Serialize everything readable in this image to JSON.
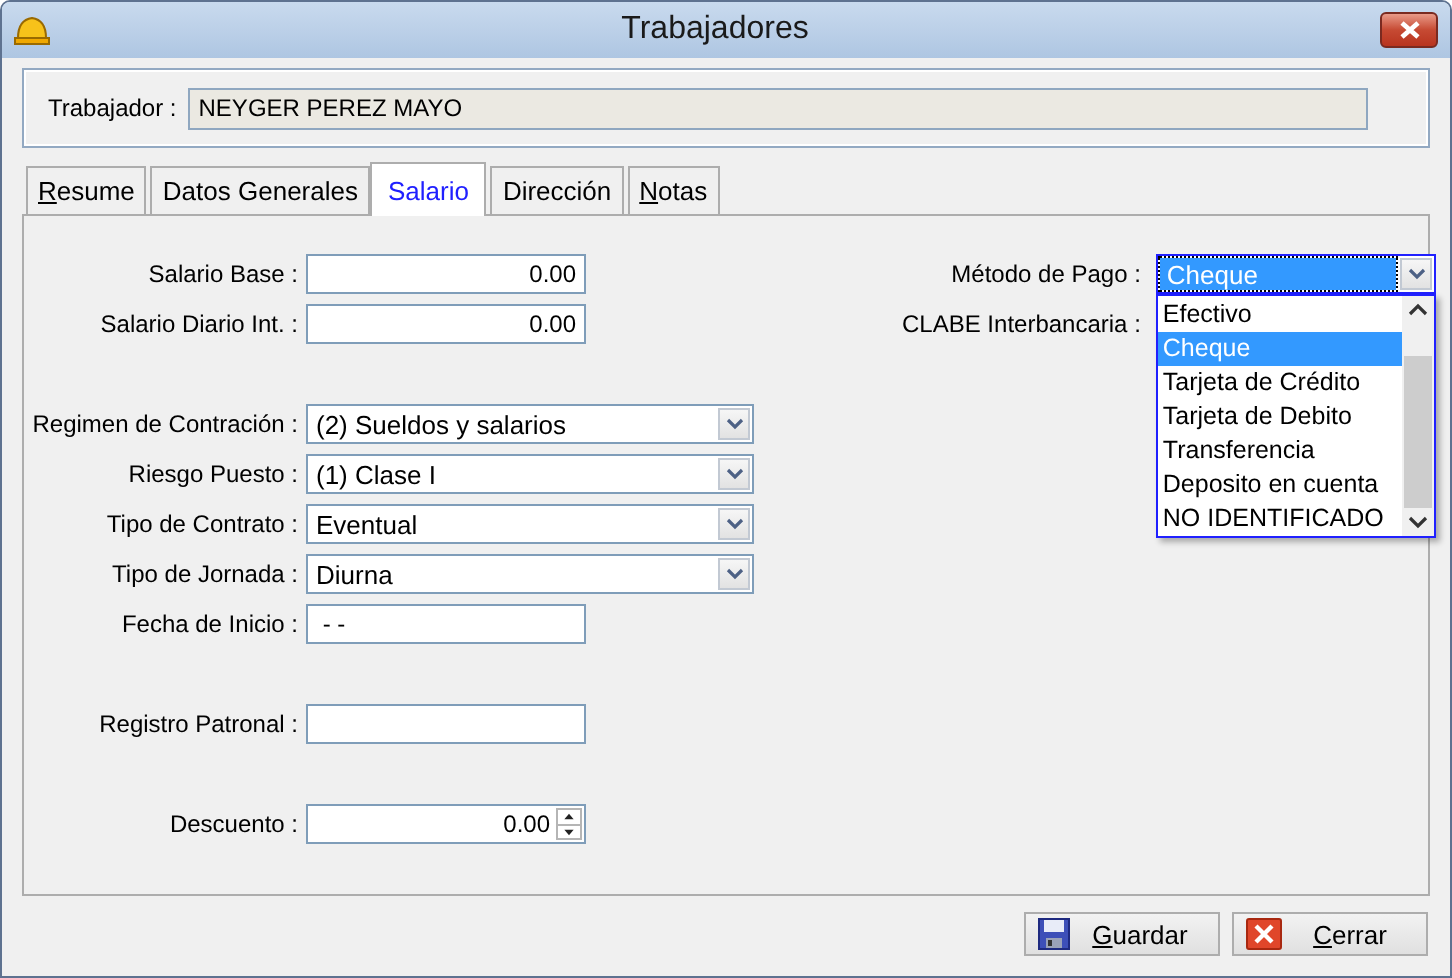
{
  "window": {
    "title": "Trabajadores"
  },
  "worker": {
    "label": "Trabajador :",
    "value": "NEYGER PEREZ MAYO"
  },
  "tabs": [
    {
      "label": "Resume",
      "underline_first": true,
      "selected": false
    },
    {
      "label": "Datos Generales",
      "selected": false
    },
    {
      "label": "Salario",
      "selected": true
    },
    {
      "label": "Dirección",
      "selected": false
    },
    {
      "label": "Notas",
      "underline_first": true,
      "selected": false
    }
  ],
  "field_groups": [
    [
      {
        "kind": "number",
        "label": "Salario Base :",
        "value": "0.00"
      },
      {
        "kind": "number",
        "label": "Salario Diario Int. :",
        "value": "0.00"
      }
    ],
    [
      {
        "kind": "select",
        "label": "Regimen de Contración :",
        "value": "(2) Sueldos y salarios"
      },
      {
        "kind": "select",
        "label": "Riesgo Puesto :",
        "value": "(1) Clase I"
      },
      {
        "kind": "select",
        "label": "Tipo de Contrato :",
        "value": "Eventual"
      },
      {
        "kind": "select",
        "label": "Tipo de Jornada :",
        "value": "Diurna"
      },
      {
        "kind": "date",
        "label": "Fecha de Inicio :",
        "value": " - -"
      }
    ],
    [
      {
        "kind": "text",
        "label": "Registro Patronal :"
      }
    ],
    [
      {
        "kind": "spin",
        "label": "Descuento :",
        "value": "0.00"
      }
    ]
  ],
  "payment": {
    "label": "Método de Pago :",
    "value": "Cheque",
    "expanded": true,
    "options": [
      {
        "label": "Efectivo",
        "selected": false
      },
      {
        "label": "Cheque",
        "selected": true
      },
      {
        "label": "Tarjeta de Crédito",
        "selected": false
      },
      {
        "label": "Tarjeta de Debito",
        "selected": false
      },
      {
        "label": "Transferencia",
        "selected": false
      },
      {
        "label": "Deposito en cuenta",
        "selected": false
      },
      {
        "label": "NO IDENTIFICADO",
        "selected": false
      }
    ]
  },
  "clabe": {
    "label": "CLABE Interbancaria :"
  },
  "buttons": [
    {
      "kind": "save",
      "label": "Guardar",
      "underline_first": true
    },
    {
      "kind": "close",
      "label": "Cerrar",
      "underline_first": true
    }
  ]
}
